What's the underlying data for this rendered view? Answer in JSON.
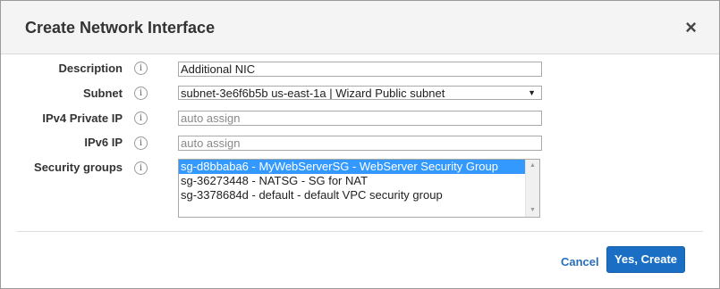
{
  "dialog": {
    "title": "Create Network Interface",
    "close_glyph": "×",
    "cancel_label": "Cancel",
    "create_label": "Yes, Create"
  },
  "fields": {
    "description": {
      "label": "Description",
      "value": "Additional NIC"
    },
    "subnet": {
      "label": "Subnet",
      "value": "subnet-3e6f6b5b us-east-1a | Wizard Public subnet"
    },
    "ipv4": {
      "label": "IPv4 Private IP",
      "placeholder": "auto assign"
    },
    "ipv6": {
      "label": "IPv6 IP",
      "placeholder": "auto assign"
    },
    "security_groups": {
      "label": "Security groups",
      "options": [
        "sg-d8bbaba6 - MyWebServerSG - WebServer Security Group",
        "sg-36273448 - NATSG - SG for NAT",
        "sg-3378684d - default - default VPC security group"
      ],
      "selected_index": 0
    }
  },
  "info_glyph": "i",
  "icons": {
    "info": "info-icon",
    "close": "close-icon",
    "dropdown": "chevron-down-icon"
  },
  "colors": {
    "primary_button": "#1a6fc4",
    "link": "#2a6ebb",
    "selection": "#3399ff"
  }
}
